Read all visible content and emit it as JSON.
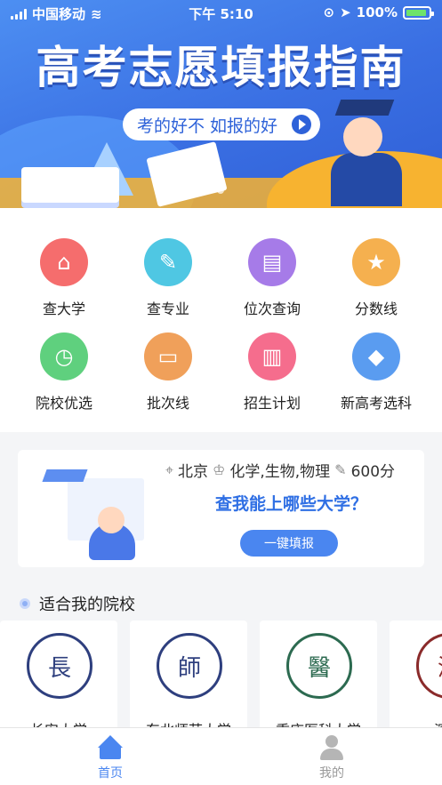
{
  "status_bar": {
    "carrier": "中国移动",
    "time": "下午 5:10",
    "battery": "100%"
  },
  "banner": {
    "title": "高考志愿填报指南",
    "subtitle": "考的好不 如报的好"
  },
  "menu": [
    {
      "label": "查大学",
      "icon": "school-icon",
      "color": "#f56d6d"
    },
    {
      "label": "查专业",
      "icon": "palette-icon",
      "color": "#4fc7e3"
    },
    {
      "label": "位次查询",
      "icon": "book-icon",
      "color": "#a67be8"
    },
    {
      "label": "分数线",
      "icon": "star-icon",
      "color": "#f5b04f"
    },
    {
      "label": "院校优选",
      "icon": "clock-icon",
      "color": "#5fd07e"
    },
    {
      "label": "批次线",
      "icon": "monitor-icon",
      "color": "#f0a05a"
    },
    {
      "label": "招生计划",
      "icon": "document-icon",
      "color": "#f56d8d"
    },
    {
      "label": "新高考选科",
      "icon": "graduation-cap-icon",
      "color": "#5a9cf0"
    }
  ],
  "quick_fill": {
    "location": "北京",
    "subjects": "化学,生物,物理",
    "score": "600分",
    "cta": "查我能上哪些大学？",
    "button": "一键填报"
  },
  "section": {
    "title": "适合我的院校"
  },
  "universities": [
    {
      "name": "长安大学",
      "logo": "長"
    },
    {
      "name": "东北师范大学",
      "logo": "師"
    },
    {
      "name": "重庆医科大学",
      "logo": "醫"
    },
    {
      "name": "深圳",
      "logo": "深"
    }
  ],
  "tabbar": {
    "home": "首页",
    "mine": "我的"
  },
  "colors": {
    "primary": "#4a86f0",
    "cta": "#2f6fe4",
    "inactive": "#9a9a9a"
  }
}
